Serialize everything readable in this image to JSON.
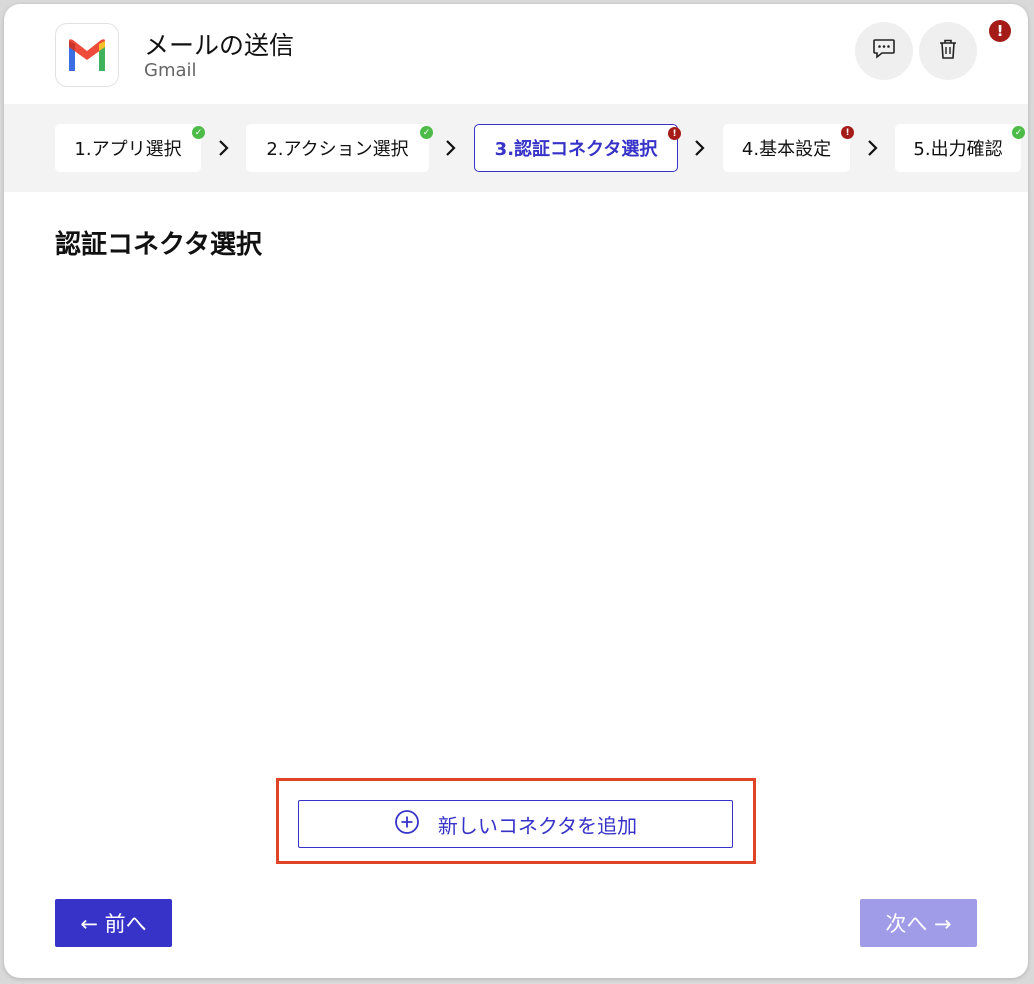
{
  "header": {
    "title": "メールの送信",
    "subtitle": "Gmail",
    "app_icon": "gmail-logo",
    "comment_icon": "comment-dots-icon",
    "delete_icon": "trash-icon",
    "alert_badge": "!"
  },
  "steps": [
    {
      "label": "1.アプリ選択",
      "status": "complete"
    },
    {
      "label": "2.アクション選択",
      "status": "complete"
    },
    {
      "label": "3.認証コネクタ選択",
      "status": "error",
      "active": true
    },
    {
      "label": "4.基本設定",
      "status": "error"
    },
    {
      "label": "5.出力確認",
      "status": "complete"
    }
  ],
  "step_marks": {
    "ok": "✓",
    "err": "!"
  },
  "main": {
    "title": "認証コネクタ選択",
    "add_connector_label": "新しいコネクタを追加",
    "add_icon": "plus-circle-icon"
  },
  "footer": {
    "prev_label": "← 前へ",
    "next_label": "次へ →",
    "next_disabled": true
  },
  "colors": {
    "accent": "#3733c8",
    "accent_disabled": "#a19ce8",
    "success": "#4cbb47",
    "error": "#a51b17",
    "highlight": "#e04426",
    "steps_background": "#f3f3f3"
  }
}
